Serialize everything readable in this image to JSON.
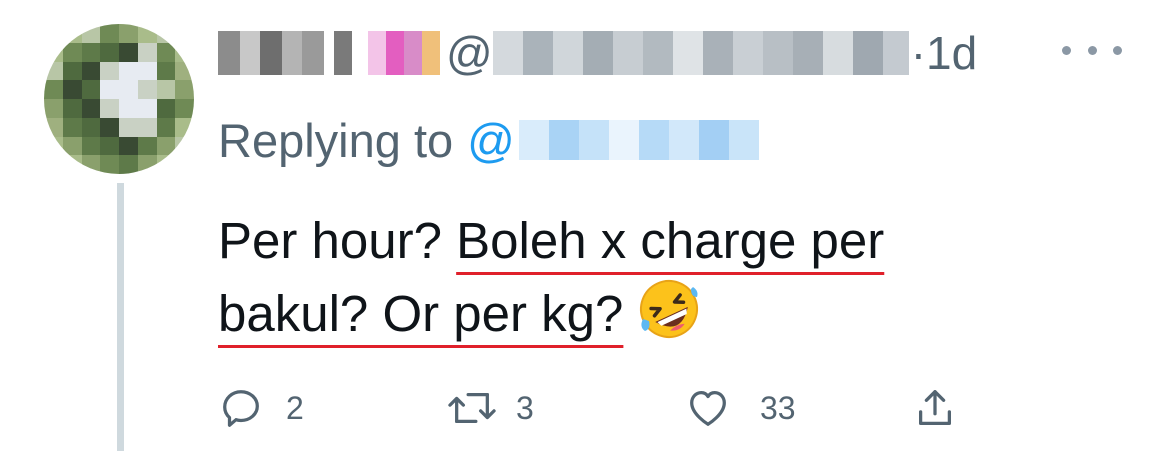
{
  "tweet": {
    "author_name": "",
    "handle_prefix": "@",
    "timestamp": "·1d",
    "replying_to_label": "Replying to",
    "replying_to_prefix": "@",
    "text_plain": "Per hour? ",
    "text_underlined_1": "Boleh x charge per",
    "text_underlined_2": "bakul? Or per kg?",
    "emoji_icon": "rolling-on-floor-laughing-emoji"
  },
  "actions": {
    "reply_count": "2",
    "retweet_count": "3",
    "like_count": "33",
    "reply_icon": "comment-bubble-icon",
    "retweet_icon": "retweet-icon",
    "like_icon": "heart-icon",
    "share_icon": "share-icon"
  },
  "colors": {
    "text": "#0f1419",
    "secondary": "#536471",
    "mention": "#1d9bf0",
    "underline": "#e0202a",
    "thread_line": "#cfd9de"
  }
}
